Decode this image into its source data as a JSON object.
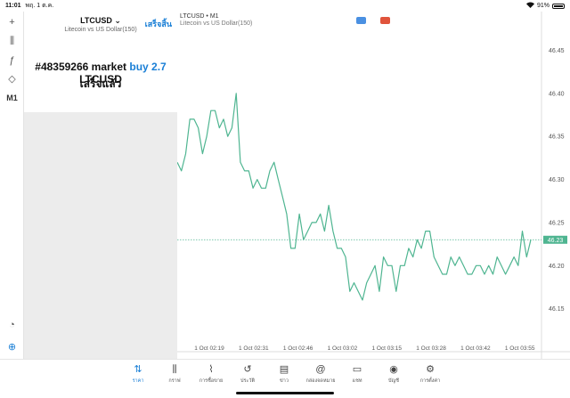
{
  "status_bar": {
    "time": "11:01",
    "date": "พฤ. 1 ต.ค.",
    "battery": "91%"
  },
  "toolbar": [
    {
      "name": "crosshair-icon",
      "glyph": "+"
    },
    {
      "name": "candles-icon",
      "glyph": "⫼"
    },
    {
      "name": "function-icon",
      "glyph": "ƒ"
    },
    {
      "name": "shapes-icon",
      "glyph": "◇"
    },
    {
      "name": "timeframe-label",
      "glyph": "M1"
    },
    {
      "name": "alert-icon",
      "glyph": "◔"
    },
    {
      "name": "add-indicator-icon",
      "glyph": "⊕"
    }
  ],
  "panel": {
    "symbol": "LTCUSD ⌄",
    "symbol_desc": "Litecoin vs US Dollar(150)",
    "done_label": "เสร็จสิ้น",
    "order_prefix": "#48359266 market",
    "order_side": "buy 2.7",
    "order_symbol": "LTCUSD",
    "order_status": "เสร็จแล้ว"
  },
  "chart": {
    "title": "LTCUSD • M1",
    "subtitle": "Litecoin vs US Dollar(150)",
    "chip_colors": [
      "#4a90e2",
      "#e0543c"
    ],
    "line_color": "#4fb591",
    "current_price": "46.23"
  },
  "chart_data": {
    "type": "line",
    "series": [
      {
        "values": [
          46.32,
          46.31,
          46.33,
          46.37,
          46.37,
          46.36,
          46.33,
          46.35,
          46.38,
          46.38,
          46.36,
          46.37,
          46.35,
          46.36,
          46.4,
          46.32,
          46.31,
          46.31,
          46.29,
          46.3,
          46.29,
          46.29,
          46.31,
          46.32,
          46.3,
          46.28,
          46.26,
          46.22,
          46.22,
          46.26,
          46.23,
          46.24,
          46.25,
          46.25,
          46.26,
          46.24,
          46.27,
          46.24,
          46.22,
          46.22,
          46.21,
          46.17,
          46.18,
          46.17,
          46.16,
          46.18,
          46.19,
          46.2,
          46.17,
          46.21,
          46.2,
          46.2,
          46.17,
          46.2,
          46.2,
          46.22,
          46.21,
          46.23,
          46.22,
          46.24,
          46.24,
          46.21,
          46.2,
          46.19,
          46.19,
          46.21,
          46.2,
          46.21,
          46.2,
          46.19,
          46.19,
          46.2,
          46.2,
          46.19,
          46.2,
          46.19,
          46.21,
          46.2,
          46.19,
          46.2,
          46.21,
          46.2,
          46.24,
          46.21,
          46.23
        ]
      }
    ],
    "x_tick_labels": [
      "1 Oct 02:19",
      "1 Oct 02:31",
      "1 Oct 02:46",
      "1 Oct 03:02",
      "1 Oct 03:15",
      "1 Oct 03:28",
      "1 Oct 03:42",
      "1 Oct 03:55"
    ],
    "y_ticks": [
      46.45,
      46.4,
      46.35,
      46.3,
      46.25,
      46.2,
      46.15
    ],
    "ylim": [
      46.1,
      46.495
    ],
    "current_price": 46.23
  },
  "bottom_nav": [
    {
      "name": "nav-quotes",
      "icon": "⇅",
      "label": "ราคา",
      "active": true
    },
    {
      "name": "nav-chart",
      "icon": "⫼",
      "label": "กราฟ",
      "active": false
    },
    {
      "name": "nav-trade",
      "icon": "⌇",
      "label": "การซื้อขาย",
      "active": false
    },
    {
      "name": "nav-history",
      "icon": "↺",
      "label": "ประวัติ",
      "active": false
    },
    {
      "name": "nav-news",
      "icon": "▤",
      "label": "ข่าว",
      "active": false
    },
    {
      "name": "nav-mailbox",
      "icon": "@",
      "label": "กล่องจดหมาย",
      "active": false
    },
    {
      "name": "nav-chat",
      "icon": "▭",
      "label": "แชท",
      "active": false
    },
    {
      "name": "nav-accounts",
      "icon": "◉",
      "label": "บัญชี",
      "active": false
    },
    {
      "name": "nav-settings",
      "icon": "⚙",
      "label": "การตั้งค่า",
      "active": false
    }
  ]
}
